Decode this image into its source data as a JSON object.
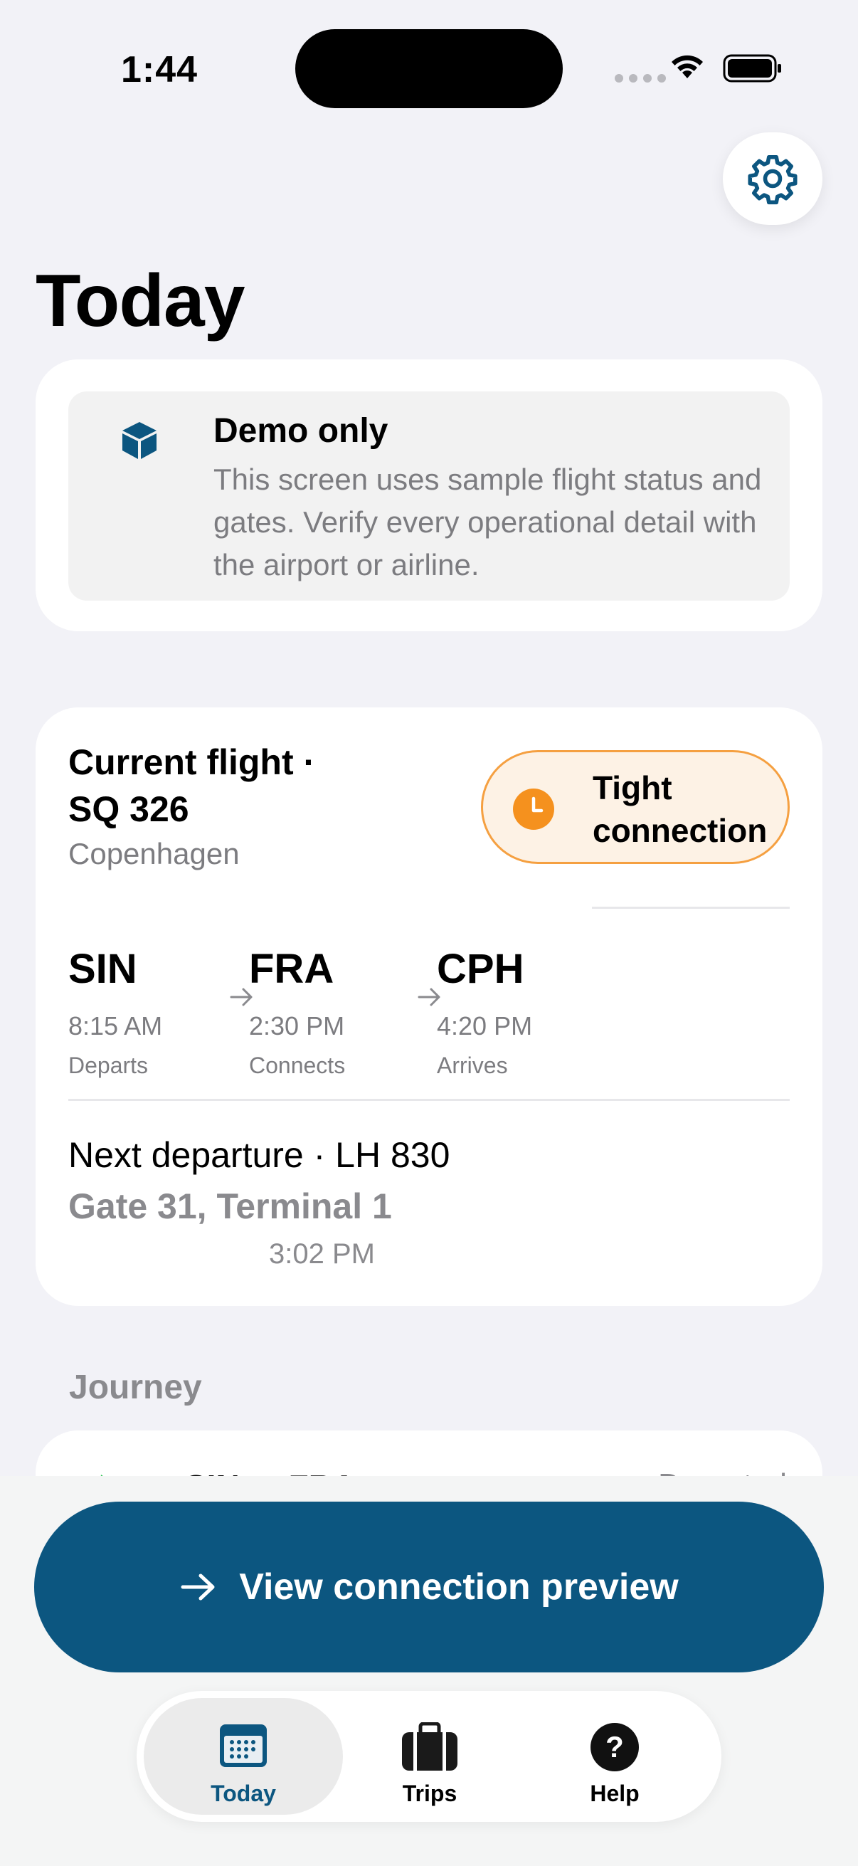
{
  "status_bar": {
    "time": "1:44"
  },
  "page": {
    "title": "Today"
  },
  "demo_notice": {
    "title": "Demo only",
    "text": "This screen uses sample flight status and gates. Verify every operational detail with the airport or airline."
  },
  "current_flight": {
    "title": "Current flight · SQ 326",
    "city": "Copenhagen",
    "badge": {
      "label": "Tight connection",
      "color": "#f5a041"
    },
    "route": [
      {
        "code": "SIN",
        "time": "8:15 AM",
        "role": "Departs"
      },
      {
        "code": "FRA",
        "time": "2:30 PM",
        "role": "Connects"
      },
      {
        "code": "CPH",
        "time": "4:20 PM",
        "role": "Arrives"
      }
    ],
    "next_departure": {
      "label": "Next departure · LH 830",
      "gate": "Gate 31, Terminal 1",
      "time": "3:02 PM"
    }
  },
  "journey": {
    "section_label": "Journey",
    "first_item": {
      "route": "SIN to FRA",
      "status": "Departed",
      "icon": "plane-icon"
    }
  },
  "cta": {
    "label": "View connection preview",
    "icon": "arrow-right-icon"
  },
  "tab_bar": {
    "tabs": [
      {
        "label": "Today",
        "icon": "calendar-icon",
        "active": true
      },
      {
        "label": "Trips",
        "icon": "suitcase-icon",
        "active": false
      },
      {
        "label": "Help",
        "icon": "question-icon",
        "active": false
      }
    ]
  },
  "colors": {
    "accent": "#0c5680",
    "warning": "#f5a041",
    "background": "#f2f2f7"
  }
}
